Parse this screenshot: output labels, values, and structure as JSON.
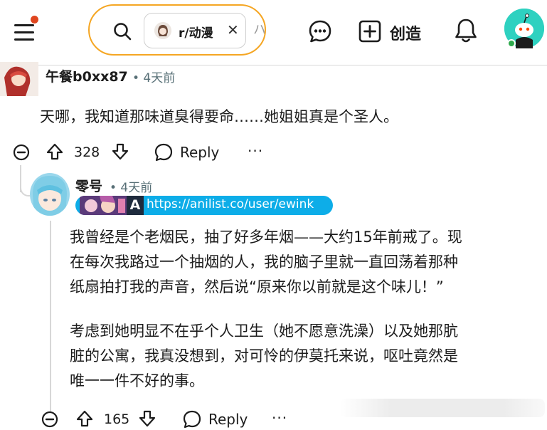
{
  "header": {
    "search": {
      "community_chip": "r/动漫",
      "trailing_text": "ハ"
    },
    "create_label": "创造"
  },
  "comments": [
    {
      "author": "午餐b0xx87",
      "time": "• 4天前",
      "body": "天哪，我知道那味道臭得要命……她姐姐真是个圣人。",
      "score": "328",
      "reply_label": "Reply",
      "more_label": "···"
    },
    {
      "author": "零号",
      "time": "• 4天前",
      "flair": {
        "logo_letter": "A",
        "link": "https://anilist.co/user/ewink"
      },
      "paragraphs": [
        [
          "我曾经是个老烟民，抽了好多年烟——大约15年前戒了。现",
          "在每次我路过一个抽烟的人，我的脑子里就一直回荡着那种",
          "纸扇拍打我的声音，然后说“原来你以前就是这个味儿！”"
        ],
        [
          "考虑到她明显不在乎个人卫生（她不愿意洗澡）以及她那肮",
          "脏的公寓，我真没想到，对可怜的伊莫托来说，呕吐竟然是",
          "唯一一件不好的事。"
        ]
      ],
      "score": "165",
      "reply_label": "Reply",
      "more_label": "···"
    }
  ],
  "colors": {
    "search_border": "#f5a623",
    "notification_dot": "#e0461f",
    "flair_bg": "#0dade8",
    "meta_text": "#576f76",
    "avatar_bg": "#2ed1c0"
  },
  "icons": [
    "menu-icon",
    "search-icon",
    "close-icon",
    "chat-icon",
    "plus-icon",
    "bell-icon",
    "collapse-icon",
    "upvote-icon",
    "downvote-icon",
    "reply-icon"
  ]
}
